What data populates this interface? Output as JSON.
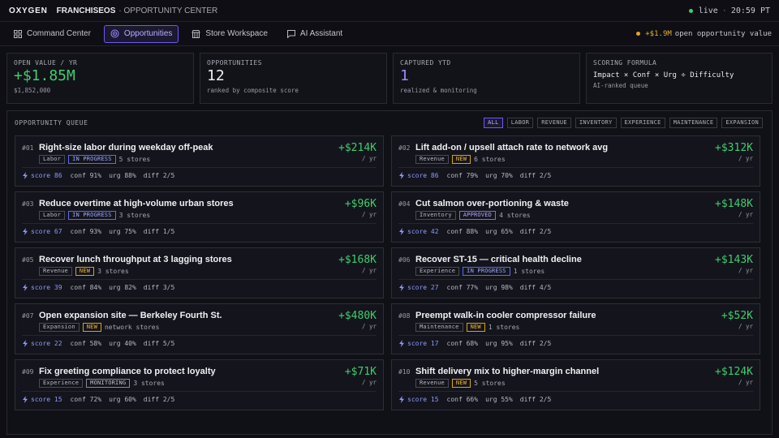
{
  "header": {
    "brand": "OXYGEN",
    "app": "FRANCHISEOS",
    "section": "· OPPORTUNITY CENTER",
    "status": "live",
    "time": "20:59 PT"
  },
  "nav": {
    "tabs": [
      {
        "label": "Command Center",
        "icon": "grid-icon"
      },
      {
        "label": "Opportunities",
        "icon": "target-icon",
        "active": true
      },
      {
        "label": "Store Workspace",
        "icon": "store-icon"
      },
      {
        "label": "AI Assistant",
        "icon": "chat-icon"
      }
    ],
    "right_value": "+$1.9M",
    "right_label": "open opportunity value"
  },
  "stats": [
    {
      "label": "OPEN VALUE / YR",
      "value": "+$1.85M",
      "sub": "$1,852,000"
    },
    {
      "label": "OPPORTUNITIES",
      "value": "12",
      "sub": "ranked by composite score"
    },
    {
      "label": "CAPTURED YTD",
      "value": "1",
      "sub": "realized & monitoring"
    },
    {
      "label": "SCORING FORMULA",
      "value": "Impact × Conf × Urg ÷ Difficulty",
      "sub": "AI-ranked queue"
    }
  ],
  "queue": {
    "title": "OPPORTUNITY QUEUE",
    "filters": [
      "ALL",
      "LABOR",
      "REVENUE",
      "INVENTORY",
      "EXPERIENCE",
      "MAINTENANCE",
      "EXPANSION"
    ],
    "yr_label": "/ yr",
    "cards": [
      {
        "rank": "#01",
        "title": "Right-size labor during weekday off-peak",
        "category": "Labor",
        "status": "IN PROGRESS",
        "status_kind": "progress",
        "stores": "5 stores",
        "value": "+$214K",
        "score": "score 86",
        "conf": "conf 91%",
        "urg": "urg 88%",
        "diff": "diff 2/5"
      },
      {
        "rank": "#02",
        "title": "Lift add-on / upsell attach rate to network avg",
        "category": "Revenue",
        "status": "NEW",
        "status_kind": "new",
        "stores": "6 stores",
        "value": "+$312K",
        "score": "score 86",
        "conf": "conf 79%",
        "urg": "urg 70%",
        "diff": "diff 2/5"
      },
      {
        "rank": "#03",
        "title": "Reduce overtime at high-volume urban stores",
        "category": "Labor",
        "status": "IN PROGRESS",
        "status_kind": "progress",
        "stores": "3 stores",
        "value": "+$96K",
        "score": "score 67",
        "conf": "conf 93%",
        "urg": "urg 75%",
        "diff": "diff 1/5"
      },
      {
        "rank": "#04",
        "title": "Cut salmon over-portioning & waste",
        "category": "Inventory",
        "status": "APPROVED",
        "status_kind": "approved",
        "stores": "4 stores",
        "value": "+$148K",
        "score": "score 42",
        "conf": "conf 88%",
        "urg": "urg 65%",
        "diff": "diff 2/5"
      },
      {
        "rank": "#05",
        "title": "Recover lunch throughput at 3 lagging stores",
        "category": "Revenue",
        "status": "NEW",
        "status_kind": "new",
        "stores": "3 stores",
        "value": "+$168K",
        "score": "score 39",
        "conf": "conf 84%",
        "urg": "urg 82%",
        "diff": "diff 3/5"
      },
      {
        "rank": "#06",
        "title": "Recover ST-15 — critical health decline",
        "category": "Experience",
        "status": "IN PROGRESS",
        "status_kind": "progress",
        "stores": "1 stores",
        "value": "+$143K",
        "score": "score 27",
        "conf": "conf 77%",
        "urg": "urg 98%",
        "diff": "diff 4/5"
      },
      {
        "rank": "#07",
        "title": "Open expansion site — Berkeley Fourth St.",
        "category": "Expansion",
        "status": "NEW",
        "status_kind": "new",
        "stores": "network stores",
        "value": "+$480K",
        "score": "score 22",
        "conf": "conf 58%",
        "urg": "urg 40%",
        "diff": "diff 5/5"
      },
      {
        "rank": "#08",
        "title": "Preempt walk-in cooler compressor failure",
        "category": "Maintenance",
        "status": "NEW",
        "status_kind": "new",
        "stores": "1 stores",
        "value": "+$52K",
        "score": "score 17",
        "conf": "conf 68%",
        "urg": "urg 95%",
        "diff": "diff 2/5"
      },
      {
        "rank": "#09",
        "title": "Fix greeting compliance to protect loyalty",
        "category": "Experience",
        "status": "MONITORING",
        "status_kind": "monitoring",
        "stores": "3 stores",
        "value": "+$71K",
        "score": "score 15",
        "conf": "conf 72%",
        "urg": "urg 60%",
        "diff": "diff 2/5"
      },
      {
        "rank": "#10",
        "title": "Shift delivery mix to higher-margin channel",
        "category": "Revenue",
        "status": "NEW",
        "status_kind": "new",
        "stores": "5 stores",
        "value": "+$124K",
        "score": "score 15",
        "conf": "conf 66%",
        "urg": "urg 55%",
        "diff": "diff 2/5"
      }
    ]
  }
}
